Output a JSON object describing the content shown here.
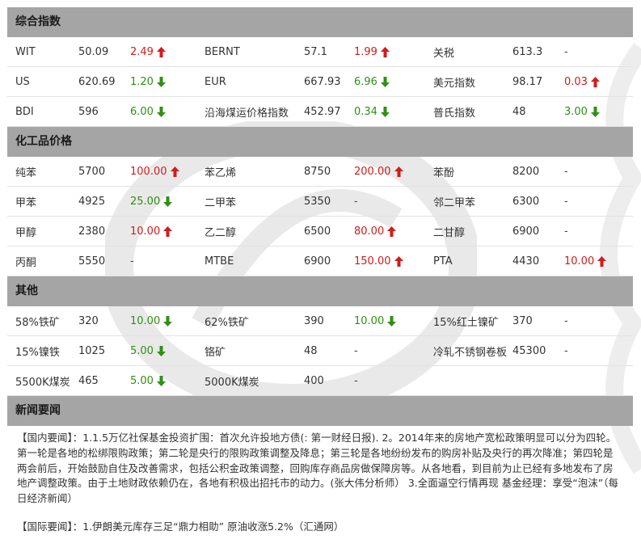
{
  "colors": {
    "up": "#d01c1c",
    "down": "#2f8f14",
    "header_bg": "#a5a5a5"
  },
  "icons": {
    "up": "red-up-arrow-icon",
    "down": "green-down-arrow-icon"
  },
  "sections": {
    "composite": {
      "title": "综合指数",
      "rows": [
        [
          {
            "name": "WIT",
            "price": "50.09",
            "change": "2.49",
            "dir": "up"
          },
          {
            "name": "BERNT",
            "price": "57.1",
            "change": "1.99",
            "dir": "up"
          },
          {
            "name": "关税",
            "price": "613.3",
            "change": "-",
            "dir": "none"
          }
        ],
        [
          {
            "name": "US",
            "price": "620.69",
            "change": "1.20",
            "dir": "down"
          },
          {
            "name": "EUR",
            "price": "667.93",
            "change": "6.96",
            "dir": "down"
          },
          {
            "name": "美元指数",
            "price": "98.17",
            "change": "0.03",
            "dir": "up"
          }
        ],
        [
          {
            "name": "BDI",
            "price": "596",
            "change": "6.00",
            "dir": "down"
          },
          {
            "name": "沿海煤运价格指数",
            "price": "452.97",
            "change": "0.34",
            "dir": "down"
          },
          {
            "name": "普氏指数",
            "price": "48",
            "change": "3.00",
            "dir": "down"
          }
        ]
      ]
    },
    "chemical": {
      "title": "化工品价格",
      "rows": [
        [
          {
            "name": "纯苯",
            "price": "5700",
            "change": "100.00",
            "dir": "up"
          },
          {
            "name": "苯乙烯",
            "price": "8750",
            "change": "200.00",
            "dir": "up"
          },
          {
            "name": "苯酚",
            "price": "8200",
            "change": "-",
            "dir": "none"
          }
        ],
        [
          {
            "name": "甲苯",
            "price": "4925",
            "change": "25.00",
            "dir": "down"
          },
          {
            "name": "二甲苯",
            "price": "5350",
            "change": "-",
            "dir": "none"
          },
          {
            "name": "邻二甲苯",
            "price": "6300",
            "change": "-",
            "dir": "none"
          }
        ],
        [
          {
            "name": "甲醇",
            "price": "2380",
            "change": "10.00",
            "dir": "up"
          },
          {
            "name": "乙二醇",
            "price": "6500",
            "change": "80.00",
            "dir": "up"
          },
          {
            "name": "二甘醇",
            "price": "6900",
            "change": "-",
            "dir": "none"
          }
        ],
        [
          {
            "name": "丙酮",
            "price": "5550",
            "change": "-",
            "dir": "none"
          },
          {
            "name": "MTBE",
            "price": "6900",
            "change": "150.00",
            "dir": "up"
          },
          {
            "name": "PTA",
            "price": "4430",
            "change": "10.00",
            "dir": "up"
          }
        ]
      ]
    },
    "other": {
      "title": "其他",
      "rows": [
        [
          {
            "name": "58%铁矿",
            "price": "320",
            "change": "10.00",
            "dir": "down"
          },
          {
            "name": "62%铁矿",
            "price": "390",
            "change": "10.00",
            "dir": "down"
          },
          {
            "name": "15%红土镍矿",
            "price": "370",
            "change": "-",
            "dir": "none"
          }
        ],
        [
          {
            "name": "15%镍铁",
            "price": "1025",
            "change": "5.00",
            "dir": "down"
          },
          {
            "name": "铬矿",
            "price": "48",
            "change": "-",
            "dir": "none"
          },
          {
            "name": "冷轧不锈钢卷板",
            "price": "45300",
            "change": "-",
            "dir": "none"
          }
        ],
        [
          {
            "name": "5500K煤炭",
            "price": "465",
            "change": "5.00",
            "dir": "down"
          },
          {
            "name": "5000K煤炭",
            "price": "400",
            "change": "-",
            "dir": "none"
          },
          {
            "name": "",
            "price": "",
            "change": "",
            "dir": "none"
          }
        ]
      ]
    },
    "news": {
      "title": "新闻要闻",
      "domestic": "【国内要闻】：1.1.5万亿社保基金投资扩围：首次允许投地方债(: 第一财经日报). 2。2014年来的房地产宽松政策明显可以分为四轮。第一轮是各地的松绑限购政策；第二轮是央行的限购政策调整及降息；第三轮是各地纷纷发布的购房补贴及央行的再次降准；第四轮是两会前后，开始鼓励自住及改善需求，包括公积金政策调整，回购库存商品房做保障房等。从各地看，到目前为止已经有多地发布了房地产调整政策。由于土地财政依赖仍在，各地有积极出招托市的动力。(张大伟分析师） 3.全面逼空行情再现 基金经理：享受“泡沫”（每日经济新闻）",
      "international": "【国际要闻】：1.伊朗美元库存三足“鼎力相助” 原油收涨5.2%（汇通网）"
    }
  }
}
